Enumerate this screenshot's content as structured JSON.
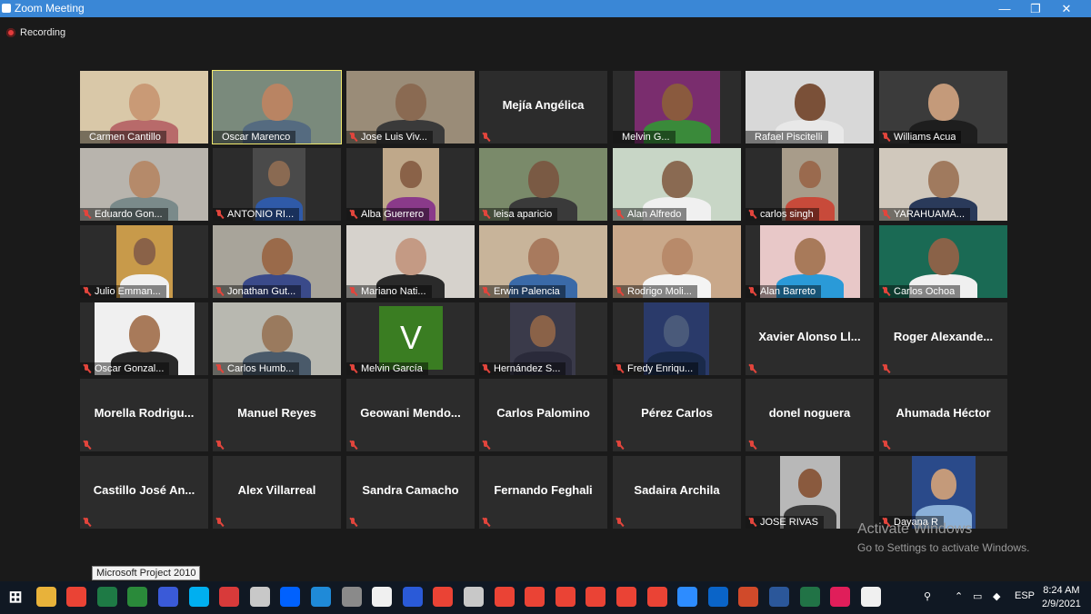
{
  "window": {
    "title": "Zoom Meeting",
    "minimize": "—",
    "restore": "❐",
    "close": "✕"
  },
  "recording": {
    "label": "Recording"
  },
  "participants": [
    {
      "name": "Carmen Cantillo",
      "muted": false
    },
    {
      "name": "Oscar Marenco",
      "muted": false
    },
    {
      "name": "Jose Luis Viv...",
      "muted": true
    },
    {
      "name": "Mejía Angélica",
      "muted": true
    },
    {
      "name": "Melvin G...",
      "muted": false
    },
    {
      "name": "Rafael Piscitelli",
      "muted": false
    },
    {
      "name": "Williams Acua",
      "muted": true
    },
    {
      "name": "Eduardo Gon...",
      "muted": true
    },
    {
      "name": "ANTONIO RI...",
      "muted": true
    },
    {
      "name": "Alba Guerrero",
      "muted": true
    },
    {
      "name": "leisa aparicio",
      "muted": true
    },
    {
      "name": "Alan Alfredo",
      "muted": true
    },
    {
      "name": "carlos singh",
      "muted": true
    },
    {
      "name": "YARAHUAMÁ...",
      "muted": true
    },
    {
      "name": "Julio Emman...",
      "muted": true
    },
    {
      "name": "Jonathan Gut...",
      "muted": true
    },
    {
      "name": "Mariano Nati...",
      "muted": true
    },
    {
      "name": "Erwin Palencia",
      "muted": true
    },
    {
      "name": "Rodrigo Moli...",
      "muted": true
    },
    {
      "name": "Alan Barreto",
      "muted": true
    },
    {
      "name": "Carlos Ochoa",
      "muted": true
    },
    {
      "name": "Oscar Gonzal...",
      "muted": true
    },
    {
      "name": "Carlos Humb...",
      "muted": true
    },
    {
      "name": "Melvin García",
      "muted": true,
      "avatar_letter": "V"
    },
    {
      "name": "Hernández S...",
      "muted": true
    },
    {
      "name": "Fredy Enriqu...",
      "muted": true
    },
    {
      "name": "Xavier Alonso Ll...",
      "muted": true
    },
    {
      "name": "Roger Alexande...",
      "muted": true
    },
    {
      "name": "Morella Rodrigu...",
      "muted": true
    },
    {
      "name": "Manuel Reyes",
      "muted": true
    },
    {
      "name": "Geowani Mendo...",
      "muted": true
    },
    {
      "name": "Carlos Palomino",
      "muted": true
    },
    {
      "name": "Pérez Carlos",
      "muted": true
    },
    {
      "name": "donel noguera",
      "muted": true
    },
    {
      "name": "Ahumada Héctor",
      "muted": true
    },
    {
      "name": "Castillo José An...",
      "muted": true
    },
    {
      "name": "Alex Villarreal",
      "muted": true
    },
    {
      "name": "Sandra Camacho",
      "muted": true
    },
    {
      "name": "Fernando Feghali",
      "muted": true
    },
    {
      "name": "Sadaira Archila",
      "muted": true
    },
    {
      "name": "JOSE RIVAS",
      "muted": true
    },
    {
      "name": "Dayana R",
      "muted": true
    }
  ],
  "watermark": {
    "line1": "Activate Windows",
    "line2": "Go to Settings to activate Windows."
  },
  "tooltip": "Microsoft Project 2010",
  "taskbar": {
    "icons": [
      "windows-start",
      "file-explorer",
      "chrome",
      "excel-green",
      "project",
      "visio",
      "skype",
      "app-red",
      "acrobat",
      "dropbox",
      "internet-explorer",
      "app-gray",
      "app-n",
      "app-blue",
      "gmail",
      "app-globe",
      "chrome-2",
      "chrome-3",
      "chrome-4",
      "chrome-5",
      "chrome-6",
      "chrome-7",
      "zoom",
      "outlook",
      "powerpoint",
      "word",
      "excel",
      "slack",
      "document"
    ],
    "language": "ESP",
    "time": "8:24 AM",
    "date": "2/9/2021"
  }
}
